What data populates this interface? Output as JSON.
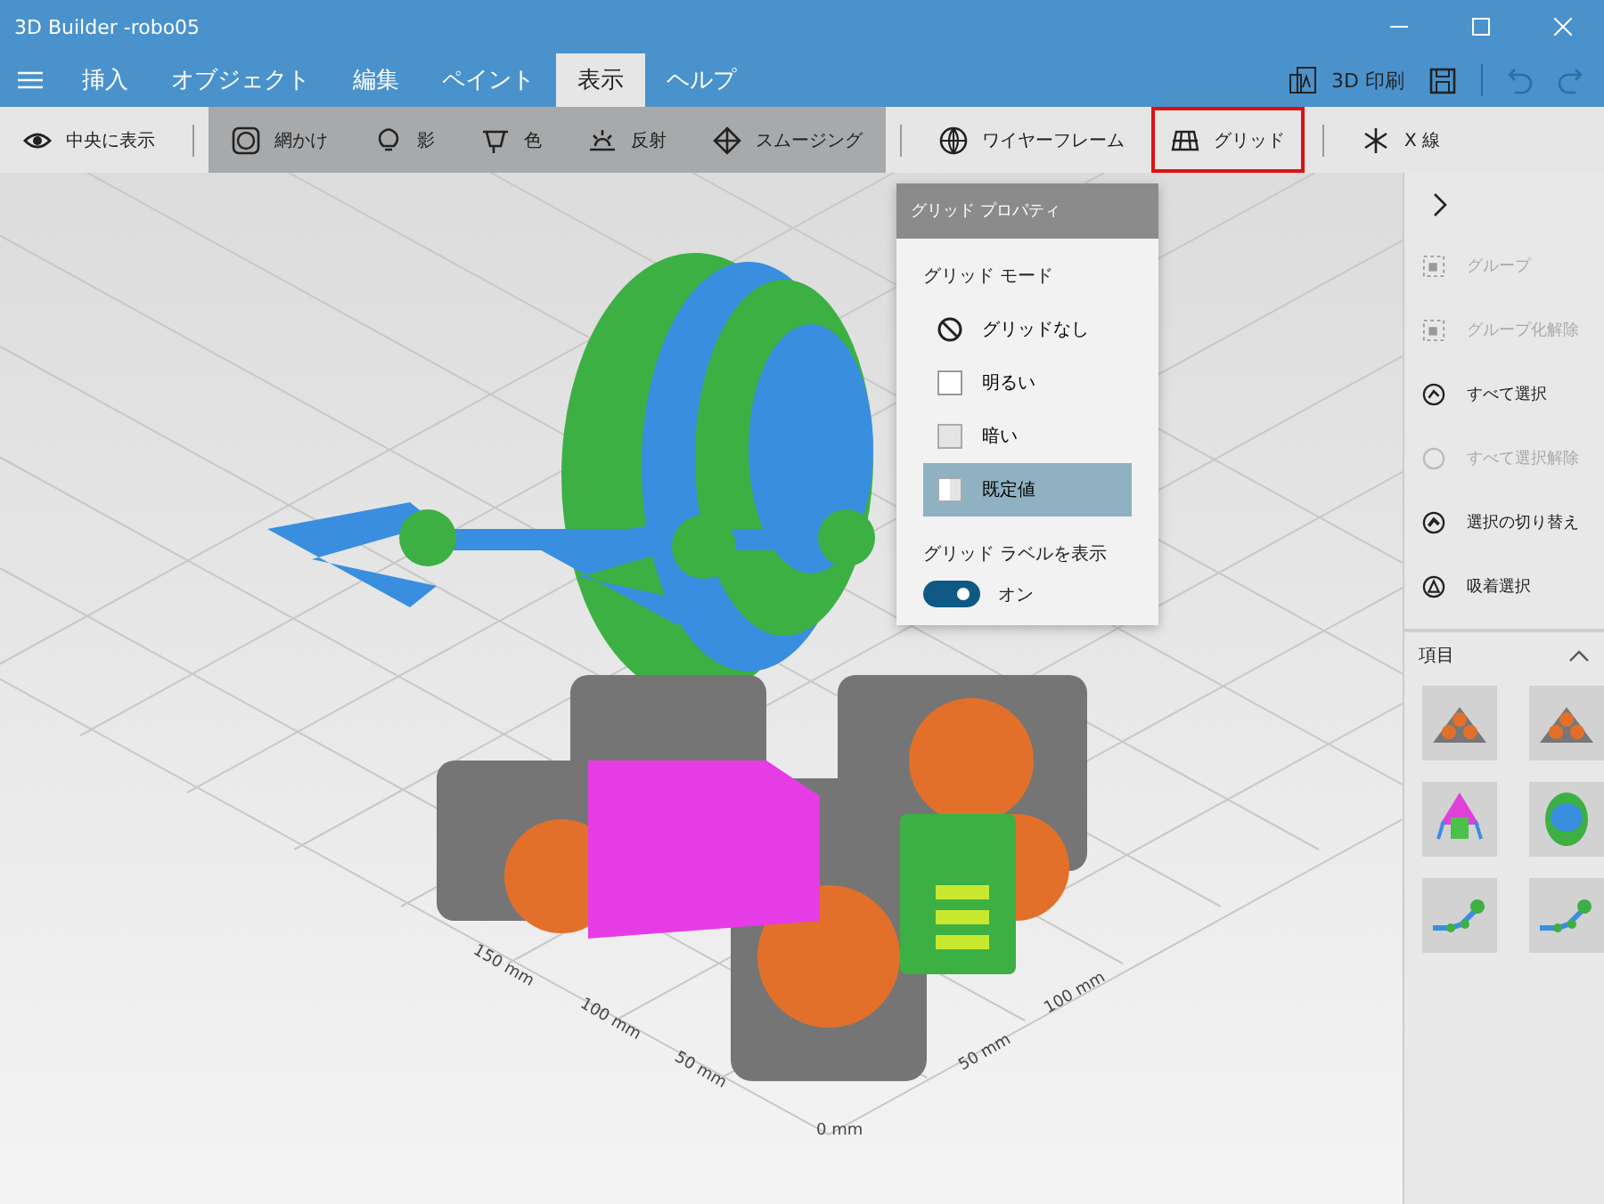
{
  "window": {
    "title": "3D Builder -robo05"
  },
  "tabs": [
    {
      "label": "挿入",
      "selected": false
    },
    {
      "label": "オブジェクト",
      "selected": false
    },
    {
      "label": "編集",
      "selected": false
    },
    {
      "label": "ペイント",
      "selected": false
    },
    {
      "label": "表示",
      "selected": true
    },
    {
      "label": "ヘルプ",
      "selected": false
    }
  ],
  "title_actions": {
    "print": "3D 印刷"
  },
  "toolbar": [
    {
      "label": "中央に表示",
      "divider_before": false,
      "on": false,
      "highlighted": false
    },
    {
      "label": "網かけ",
      "divider_before": true,
      "on": true,
      "highlighted": false
    },
    {
      "label": "影",
      "divider_before": false,
      "on": true,
      "highlighted": false
    },
    {
      "label": "色",
      "divider_before": false,
      "on": true,
      "highlighted": false
    },
    {
      "label": "反射",
      "divider_before": false,
      "on": true,
      "highlighted": false
    },
    {
      "label": "スムージング",
      "divider_before": false,
      "on": true,
      "highlighted": false
    },
    {
      "label": "ワイヤーフレーム",
      "divider_before": true,
      "on": false,
      "highlighted": false
    },
    {
      "label": "グリッド",
      "divider_before": false,
      "on": false,
      "highlighted": true
    },
    {
      "label": "X 線",
      "divider_before": true,
      "on": false,
      "highlighted": false
    }
  ],
  "grid_popup": {
    "title": "グリッド プロパティ",
    "mode_label": "グリッド モード",
    "options": [
      {
        "label": "グリッドなし",
        "selected": false
      },
      {
        "label": "明るい",
        "selected": false
      },
      {
        "label": "暗い",
        "selected": false
      },
      {
        "label": "既定値",
        "selected": true
      }
    ],
    "label_toggle": {
      "label": "グリッド ラベルを表示",
      "on": true,
      "state_text": "オン"
    }
  },
  "grid_labels": [
    "150 mm",
    "100 mm",
    "50 mm",
    "0 mm",
    "50 mm",
    "100 mm"
  ],
  "side_panel": {
    "actions": [
      {
        "label": "グループ",
        "disabled": true
      },
      {
        "label": "グループ化解除",
        "disabled": true
      },
      {
        "label": "すべて選択",
        "disabled": false
      },
      {
        "label": "すべて選択解除",
        "disabled": true
      },
      {
        "label": "選択の切り替え",
        "disabled": false
      },
      {
        "label": "吸着選択",
        "disabled": false
      }
    ],
    "items_section": {
      "title": "項目",
      "expanded": true
    }
  }
}
